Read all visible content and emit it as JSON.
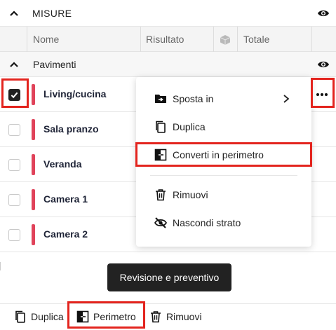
{
  "section": {
    "title": "MISURE"
  },
  "columns": {
    "name": "Nome",
    "result": "Risultato",
    "total": "Totale"
  },
  "group": {
    "label": "Pavimenti"
  },
  "rows": [
    {
      "label": "Living/cucina",
      "checked": true
    },
    {
      "label": "Sala pranzo",
      "checked": false
    },
    {
      "label": "Veranda",
      "checked": false
    },
    {
      "label": "Camera 1",
      "checked": false
    },
    {
      "label": "Camera 2",
      "checked": false
    }
  ],
  "context_menu": {
    "items": [
      {
        "label": "Sposta in",
        "icon": "folder-move-icon",
        "has_submenu": true
      },
      {
        "label": "Duplica",
        "icon": "copy-icon"
      },
      {
        "label": "Converti in perimetro",
        "icon": "convert-perimeter-icon"
      },
      {
        "label": "Rimuovi",
        "icon": "trash-icon"
      },
      {
        "label": "Nascondi strato",
        "icon": "eye-off-icon"
      }
    ]
  },
  "review_button": {
    "label": "Revisione e preventivo"
  },
  "bottom_actions": {
    "duplicate": "Duplica",
    "perimeter": "Perimetro",
    "remove": "Rimuovi"
  },
  "colors": {
    "accent_red": "#e0435a",
    "highlight": "#e3241e",
    "dark": "#222222"
  }
}
